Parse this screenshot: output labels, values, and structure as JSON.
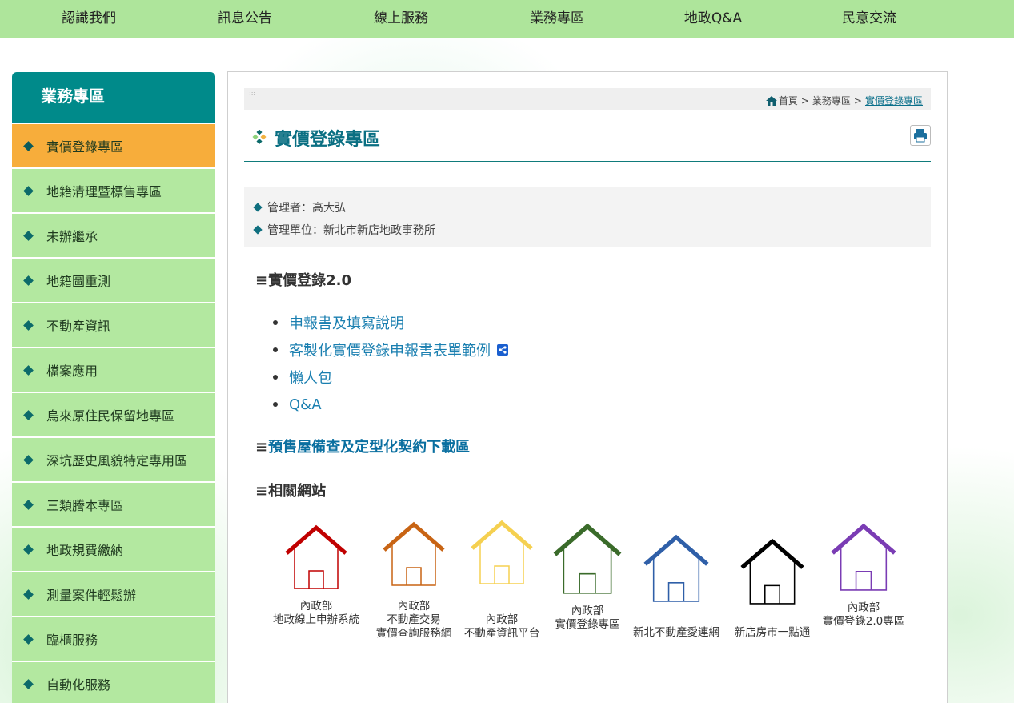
{
  "top_nav": [
    "認識我們",
    "訊息公告",
    "線上服務",
    "業務專區",
    "地政Q&A",
    "民意交流"
  ],
  "sidebar": {
    "title": "業務專區",
    "items": [
      {
        "label": "實價登錄專區",
        "active": true
      },
      {
        "label": "地籍清理暨標售專區"
      },
      {
        "label": "未辦繼承"
      },
      {
        "label": "地籍圖重測"
      },
      {
        "label": "不動產資訊"
      },
      {
        "label": "檔案應用"
      },
      {
        "label": "烏來原住民保留地專區"
      },
      {
        "label": "深坑歷史風貌特定專用區"
      },
      {
        "label": "三類謄本專區"
      },
      {
        "label": "地政規費繳納"
      },
      {
        "label": "測量案件輕鬆辦"
      },
      {
        "label": "臨櫃服務"
      },
      {
        "label": "自動化服務"
      }
    ]
  },
  "breadcrumb": {
    "dots": ":::",
    "home": "首頁",
    "sep": ">",
    "parent": "業務專區",
    "current": "實價登錄專區"
  },
  "page": {
    "title": "實價登錄專區",
    "manager": "管理者：高大弘",
    "unit": "管理單位：新北市新店地政事務所"
  },
  "sections": {
    "bars": "≡",
    "s1": "實價登錄2.0",
    "s2": "預售屋備查及定型化契約下載區",
    "s3": "相關網站"
  },
  "links": [
    "申報書及填寫說明",
    "客製化實價登錄申報書表單範例",
    "懶人包",
    "Q&A"
  ],
  "related_sites": [
    {
      "line1": "內政部",
      "line2": "地政線上申辦系統",
      "color": "#c00000"
    },
    {
      "line0": "內政部",
      "line1": "不動產交易",
      "line2": "實價查詢服務網",
      "color": "#c86414"
    },
    {
      "line1": "內政部",
      "line2": "不動產資訊平台",
      "color": "#f5d050"
    },
    {
      "line1": "內政部",
      "line2": "實價登錄專區",
      "color": "#3a6b2a"
    },
    {
      "line2": "新北不動產愛連網",
      "color": "#2f5fa8"
    },
    {
      "line2": "新店房市一點通",
      "color": "#000000"
    },
    {
      "line1": "內政部",
      "line2": "實價登錄2.0專區",
      "color": "#7a3cb4"
    }
  ]
}
